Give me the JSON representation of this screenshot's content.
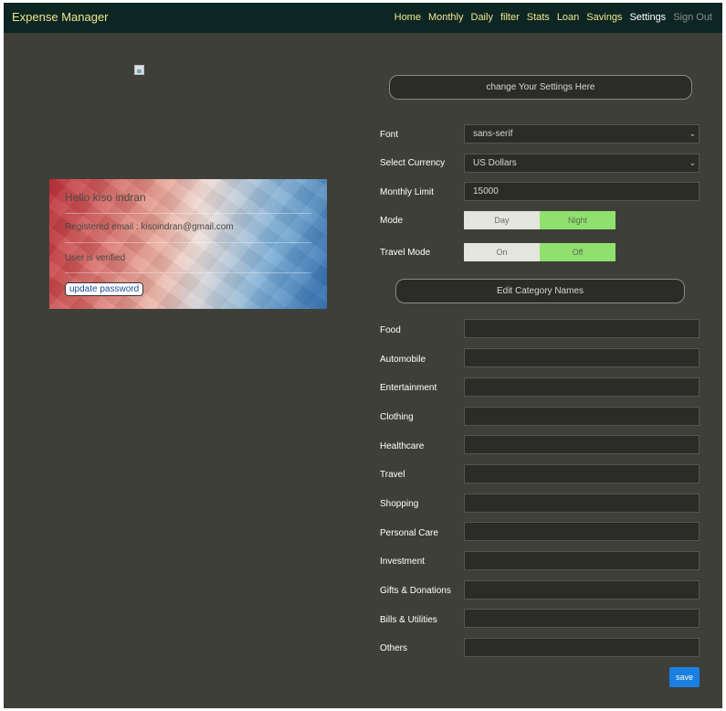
{
  "app": {
    "brand": "Expense Manager"
  },
  "nav": {
    "items": [
      {
        "label": "Home"
      },
      {
        "label": "Monthly"
      },
      {
        "label": "Daily"
      },
      {
        "label": "filter"
      },
      {
        "label": "Stats"
      },
      {
        "label": "Loan"
      },
      {
        "label": "Savings"
      },
      {
        "label": "Settings"
      },
      {
        "label": "Sign Out"
      }
    ]
  },
  "profile": {
    "hello": "Hello kiso indran",
    "email": "Registered email : kisoindran@gmail.com",
    "verified": "User is verified",
    "update_password": "update password"
  },
  "settings": {
    "header": "change Your Settings Here",
    "font_label": "Font",
    "font_value": "sans-serif",
    "currency_label": "Select Currency",
    "currency_value": "US Dollars",
    "limit_label": "Monthly Limit",
    "limit_value": "15000",
    "mode_label": "Mode",
    "mode_day": "Day",
    "mode_night": "Night",
    "mode_selected": "Night",
    "travel_label": "Travel Mode",
    "travel_on": "On",
    "travel_off": "Off",
    "travel_selected": "Off"
  },
  "categories": {
    "header": "Edit Category Names",
    "items": [
      {
        "label": "Food",
        "value": ""
      },
      {
        "label": "Automobile",
        "value": ""
      },
      {
        "label": "Entertainment",
        "value": ""
      },
      {
        "label": "Clothing",
        "value": ""
      },
      {
        "label": "Healthcare",
        "value": ""
      },
      {
        "label": "Travel",
        "value": ""
      },
      {
        "label": "Shopping",
        "value": ""
      },
      {
        "label": "Personal Care",
        "value": ""
      },
      {
        "label": "Investment",
        "value": ""
      },
      {
        "label": "Gifts & Donations",
        "value": ""
      },
      {
        "label": "Bills & Utilities",
        "value": ""
      },
      {
        "label": "Others",
        "value": ""
      }
    ]
  },
  "actions": {
    "save": "save"
  },
  "colors": {
    "accent": "#f0e68c",
    "save": "#1a7fe0",
    "selected": "#90e070"
  }
}
